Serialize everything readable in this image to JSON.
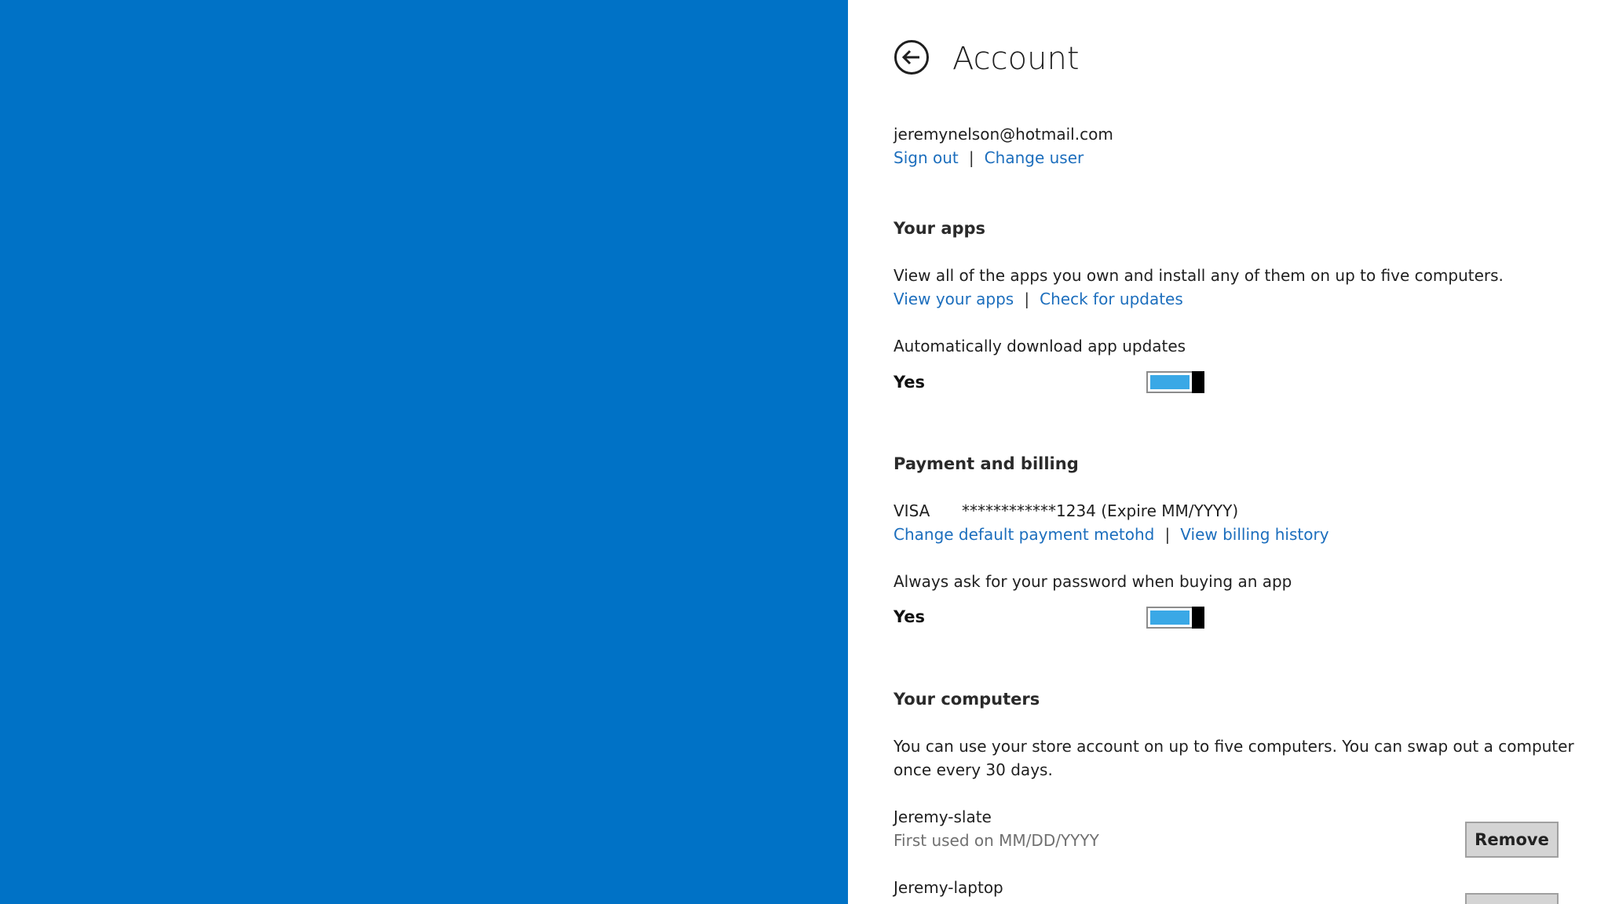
{
  "header": {
    "title": "Account",
    "back_icon": "back-arrow-circle-icon"
  },
  "account": {
    "email": "jeremynelson@hotmail.com",
    "sign_out": "Sign out",
    "change_user": "Change user",
    "separator": "|"
  },
  "apps": {
    "heading": "Your apps",
    "description": "View all of the apps you own and install any of them on up to five computers.",
    "view_apps": "View your apps",
    "check_updates": "Check for updates",
    "auto_update_label": "Automatically download app updates",
    "auto_update_value": "Yes",
    "auto_update_on": true
  },
  "billing": {
    "heading": "Payment and billing",
    "card_type": "VISA",
    "card_number": "************1234 (Expire MM/YYYY)",
    "change_payment": "Change default payment metohd",
    "view_history": "View billing history",
    "password_label": "Always ask for your password when buying an app",
    "password_value": "Yes",
    "password_on": true
  },
  "computers": {
    "heading": "Your computers",
    "description_line1": "You can use your store account on up to five computers. You can swap out a computer",
    "description_line2": "once every 30 days.",
    "items": [
      {
        "name": "Jeremy-slate",
        "first_used": "First used on MM/DD/YYYY",
        "remove_label": "Remove"
      },
      {
        "name": "Jeremy-laptop",
        "first_used": "",
        "remove_label": ""
      }
    ]
  },
  "colors": {
    "accent_blue": "#0072c6",
    "link": "#1c6ebd",
    "toggle_on": "#3aa8e6"
  }
}
